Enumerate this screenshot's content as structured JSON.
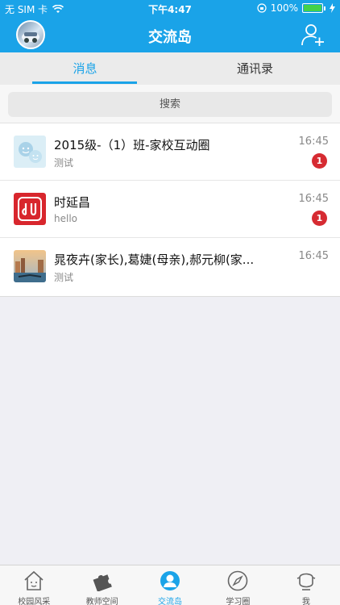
{
  "status": {
    "carrier": "无 SIM 卡",
    "time": "下午4:47",
    "battery": "100%"
  },
  "navbar": {
    "title": "交流岛"
  },
  "segments": [
    {
      "label": "消息",
      "active": true
    },
    {
      "label": "通讯录",
      "active": false
    }
  ],
  "search": {
    "label": "搜索"
  },
  "conversations": [
    {
      "title": "2015级-（1）班-家校互动圈",
      "subtitle": "测试",
      "time": "16:45",
      "badge": "1",
      "icon": "group-chat-icon"
    },
    {
      "title": "时延昌",
      "subtitle": "hello",
      "time": "16:45",
      "badge": "1",
      "icon": "app-logo-icon"
    },
    {
      "title": "晁夜卉(家长),葛婕(母亲),郝元柳(家...",
      "subtitle": "测试",
      "time": "16:45",
      "badge": null,
      "icon": "city-photo-icon"
    }
  ],
  "tabs": [
    {
      "label": "校园风采",
      "icon": "house-icon"
    },
    {
      "label": "教师空间",
      "icon": "puzzle-icon"
    },
    {
      "label": "交流岛",
      "icon": "user-circle-icon",
      "active": true
    },
    {
      "label": "学习圈",
      "icon": "compass-icon"
    },
    {
      "label": "我",
      "icon": "person-icon"
    }
  ],
  "colors": {
    "accent": "#1aa3e8",
    "badge": "#d62b32"
  }
}
